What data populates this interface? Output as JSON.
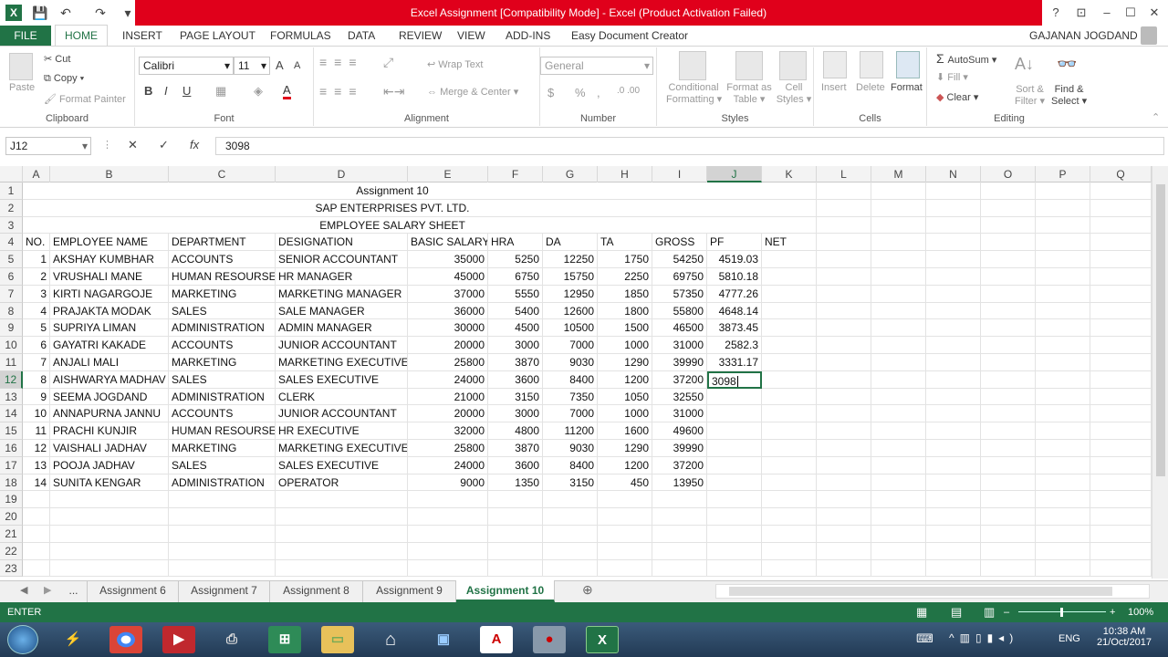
{
  "window": {
    "title": "Excel Assignment  [Compatibility Mode] -  Excel (Product Activation Failed)",
    "user": "GAJANAN JOGDAND",
    "help": "?"
  },
  "quick_access": {
    "excel_logo": "X",
    "save": "💾",
    "undo": "↶",
    "redo": "↷",
    "more": "▾"
  },
  "ribbon_tabs": [
    "FILE",
    "HOME",
    "INSERT",
    "PAGE LAYOUT",
    "FORMULAS",
    "DATA",
    "REVIEW",
    "VIEW",
    "ADD-INS",
    "Easy Document Creator"
  ],
  "ribbon": {
    "clipboard": {
      "paste": "Paste",
      "cut": "Cut",
      "copy": "Copy",
      "format_painter": "Format Painter",
      "label": "Clipboard"
    },
    "font": {
      "name": "Calibri",
      "size": "11",
      "bold": "B",
      "italic": "I",
      "underline": "U",
      "grow": "A",
      "shrink": "A",
      "label": "Font"
    },
    "alignment": {
      "wrap": "Wrap Text",
      "merge": "Merge & Center",
      "label": "Alignment"
    },
    "number": {
      "format": "General",
      "currency": "$",
      "percent": "%",
      "comma": ",",
      "label": "Number"
    },
    "styles": {
      "conditional": "Conditional",
      "conditional2": "Formatting",
      "format_table": "Format as",
      "format_table2": "Table",
      "cell_styles": "Cell",
      "cell_styles2": "Styles",
      "label": "Styles"
    },
    "cells": {
      "insert": "Insert",
      "delete": "Delete",
      "format": "Format",
      "label": "Cells"
    },
    "editing": {
      "autosum": "AutoSum",
      "fill": "Fill",
      "clear": "Clear",
      "sort": "Sort &",
      "sort2": "Filter",
      "find": "Find &",
      "find2": "Select",
      "label": "Editing"
    }
  },
  "formula_bar": {
    "name_box": "J12",
    "cancel": "✕",
    "enter": "✓",
    "fx": "fx",
    "value": "3098"
  },
  "columns": [
    "A",
    "B",
    "C",
    "D",
    "E",
    "F",
    "G",
    "H",
    "I",
    "J",
    "K",
    "L",
    "M",
    "N",
    "O",
    "P",
    "Q"
  ],
  "row_numbers": [
    "1",
    "2",
    "3",
    "4",
    "5",
    "6",
    "7",
    "8",
    "9",
    "10",
    "11",
    "12",
    "13",
    "14",
    "15",
    "16",
    "17",
    "18",
    "19",
    "20",
    "21",
    "22",
    "23"
  ],
  "sheet": {
    "title1": "Assignment 10",
    "title2": "SAP ENTERPRISES PVT. LTD.",
    "title3": "EMPLOYEE SALARY SHEET",
    "headers": [
      "NO.",
      "EMPLOYEE NAME",
      "DEPARTMENT",
      "DESIGNATION",
      "BASIC SALARY",
      "HRA",
      "DA",
      "TA",
      "GROSS",
      "PF",
      "NET"
    ],
    "rows": [
      [
        "1",
        "AKSHAY KUMBHAR",
        "ACCOUNTS",
        "SENIOR ACCOUNTANT",
        "35000",
        "5250",
        "12250",
        "1750",
        "54250",
        "4519.03",
        ""
      ],
      [
        "2",
        "VRUSHALI MANE",
        "HUMAN RESOURSE",
        "HR MANAGER",
        "45000",
        "6750",
        "15750",
        "2250",
        "69750",
        "5810.18",
        ""
      ],
      [
        "3",
        "KIRTI NAGARGOJE",
        "MARKETING",
        "MARKETING MANAGER",
        "37000",
        "5550",
        "12950",
        "1850",
        "57350",
        "4777.26",
        ""
      ],
      [
        "4",
        "PRAJAKTA MODAK",
        "SALES",
        "SALE MANAGER",
        "36000",
        "5400",
        "12600",
        "1800",
        "55800",
        "4648.14",
        ""
      ],
      [
        "5",
        "SUPRIYA LIMAN",
        "ADMINISTRATION",
        "ADMIN MANAGER",
        "30000",
        "4500",
        "10500",
        "1500",
        "46500",
        "3873.45",
        ""
      ],
      [
        "6",
        "GAYATRI KAKADE",
        "ACCOUNTS",
        "JUNIOR ACCOUNTANT",
        "20000",
        "3000",
        "7000",
        "1000",
        "31000",
        "2582.3",
        ""
      ],
      [
        "7",
        "ANJALI MALI",
        "MARKETING",
        "MARKETING EXECUTIVE",
        "25800",
        "3870",
        "9030",
        "1290",
        "39990",
        "3331.17",
        ""
      ],
      [
        "8",
        "AISHWARYA MADHAV",
        "SALES",
        "SALES EXECUTIVE",
        "24000",
        "3600",
        "8400",
        "1200",
        "37200",
        "3098",
        ""
      ],
      [
        "9",
        "SEEMA JOGDAND",
        "ADMINISTRATION",
        "CLERK",
        "21000",
        "3150",
        "7350",
        "1050",
        "32550",
        "",
        ""
      ],
      [
        "10",
        "ANNAPURNA JANNU",
        "ACCOUNTS",
        "JUNIOR ACCOUNTANT",
        "20000",
        "3000",
        "7000",
        "1000",
        "31000",
        "",
        ""
      ],
      [
        "11",
        "PRACHI KUNJIR",
        "HUMAN RESOURSE",
        "HR EXECUTIVE",
        "32000",
        "4800",
        "11200",
        "1600",
        "49600",
        "",
        ""
      ],
      [
        "12",
        "VAISHALI JADHAV",
        "MARKETING",
        "MARKETING EXECUTIVE",
        "25800",
        "3870",
        "9030",
        "1290",
        "39990",
        "",
        ""
      ],
      [
        "13",
        "POOJA JADHAV",
        "SALES",
        "SALES EXECUTIVE",
        "24000",
        "3600",
        "8400",
        "1200",
        "37200",
        "",
        ""
      ],
      [
        "14",
        "SUNITA KENGAR",
        "ADMINISTRATION",
        "OPERATOR",
        "9000",
        "1350",
        "3150",
        "450",
        "13950",
        "",
        ""
      ]
    ]
  },
  "sheet_tabs": [
    "...",
    "Assignment 6",
    "Assignment 7",
    "Assignment 8",
    "Assignment 9",
    "Assignment 10"
  ],
  "active_sheet": "Assignment 10",
  "status": {
    "mode": "ENTER",
    "zoom": "100%"
  },
  "taskbar": {
    "lang": "ENG",
    "time": "10:38 AM",
    "date": "21/Oct/2017"
  },
  "colors": {
    "excel_green": "#217346",
    "title_red": "#e0001b"
  }
}
